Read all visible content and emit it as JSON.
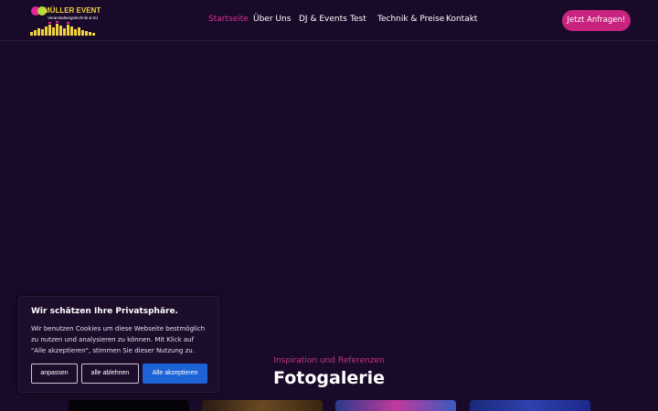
{
  "brand": {
    "name": "MÜLLER EVENT",
    "tagline": "Veranstaltungstechnik & DJ"
  },
  "nav": {
    "items": [
      "Startseite",
      "Über Uns",
      "DJ & Events",
      "Test",
      "Technik & Preise",
      "Kontakt"
    ],
    "active": "Startseite"
  },
  "cta_label": "Jetzt Anfragen!",
  "gallery": {
    "subtitle": "Inspiration und Referenzen",
    "title": "Fotogalerie"
  },
  "cookie": {
    "title": "Wir schätzen Ihre Privatsphäre.",
    "text": "Wir benutzen Cookies um diese Webseite bestmöglich zu nutzen und analysieren zu können. Mit Klick auf \"Alle akzeptieren\", stimmen Sie dieser Nutzung zu.",
    "customize_label": "anpassen",
    "reject_label": "alle ablehnen",
    "accept_label": "Alle akzeptieren"
  },
  "colors": {
    "background": "#1a0a2a",
    "accent": "#c8237e",
    "active_nav": "#d6358f",
    "accept_button": "#1d63d6"
  }
}
